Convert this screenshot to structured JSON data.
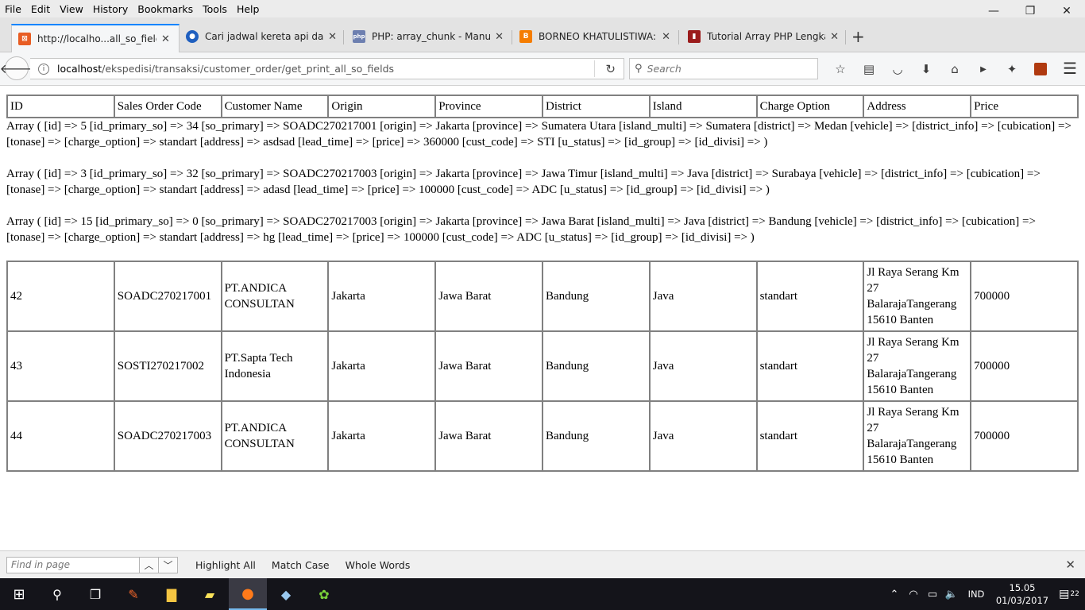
{
  "menubar": {
    "items": [
      "File",
      "Edit",
      "View",
      "History",
      "Bookmarks",
      "Tools",
      "Help"
    ]
  },
  "window_controls": {
    "minimize": "—",
    "restore": "❐",
    "close": "✕"
  },
  "tabs": [
    {
      "title": "http://localho...all_so_fields",
      "icon": "xampp-icon",
      "icon_color": "#e85d24",
      "active": true
    },
    {
      "title": "Cari jadwal kereta api dari ...",
      "icon": "train-site-icon",
      "icon_color": "#1f5fbf",
      "active": false
    },
    {
      "title": "PHP: array_chunk - Manual",
      "icon": "php-icon",
      "icon_color": "#6d7fb0",
      "active": false
    },
    {
      "title": "BORNEO KHATULISTIWA: ...",
      "icon": "blogger-icon",
      "icon_color": "#f57d00",
      "active": false
    },
    {
      "title": "Tutorial Array PHP Lengka...",
      "icon": "site-icon",
      "icon_color": "#9b1c1c",
      "active": false
    }
  ],
  "new_tab": "+",
  "nav": {
    "url_host": "localhost",
    "url_path": "/ekspedisi/transaksi/customer_order/get_print_all_so_fields",
    "search_placeholder": "Search"
  },
  "table_headers": [
    "ID",
    "Sales Order Code",
    "Customer Name",
    "Origin",
    "Province",
    "District",
    "Island",
    "Charge Option",
    "Address",
    "Price"
  ],
  "array_dump": [
    "Array ( [id] => 5 [id_primary_so] => 34 [so_primary] => SOADC270217001 [origin] => Jakarta [province] => Sumatera Utara [island_multi] => Sumatera [district] => Medan [vehicle] => [district_info] => [cubication] => [tonase] => [charge_option] => standart [address] => asdsad [lead_time] => [price] => 360000 [cust_code] => STI [u_status] => [id_group] => [id_divisi] => )",
    "Array ( [id] => 3 [id_primary_so] => 32 [so_primary] => SOADC270217003 [origin] => Jakarta [province] => Jawa Timur [island_multi] => Java [district] => Surabaya [vehicle] => [district_info] => [cubication] => [tonase] => [charge_option] => standart [address] => adasd [lead_time] => [price] => 100000 [cust_code] => ADC [u_status] => [id_group] => [id_divisi] => )",
    "Array ( [id] => 15 [id_primary_so] => 0 [so_primary] => SOADC270217003 [origin] => Jakarta [province] => Jawa Barat [island_multi] => Java [district] => Bandung [vehicle] => [district_info] => [cubication] => [tonase] => [charge_option] => standart [address] => hg [lead_time] => [price] => 100000 [cust_code] => ADC [u_status] => [id_group] => [id_divisi] => )"
  ],
  "rows": [
    [
      "42",
      "SOADC270217001",
      "PT.ANDICA CONSULTAN",
      "Jakarta",
      "Jawa Barat",
      "Bandung",
      "Java",
      "standart",
      "Jl Raya Serang Km 27 BalarajaTangerang 15610 Banten",
      "700000"
    ],
    [
      "43",
      "SOSTI270217002",
      "PT.Sapta Tech Indonesia",
      "Jakarta",
      "Jawa Barat",
      "Bandung",
      "Java",
      "standart",
      "Jl Raya Serang Km 27 BalarajaTangerang 15610 Banten",
      "700000"
    ],
    [
      "44",
      "SOADC270217003",
      "PT.ANDICA CONSULTAN",
      "Jakarta",
      "Jawa Barat",
      "Bandung",
      "Java",
      "standart",
      "Jl Raya Serang Km 27 BalarajaTangerang 15610 Banten",
      "700000"
    ]
  ],
  "findbar": {
    "placeholder": "Find in page",
    "highlight_all": "Highlight All",
    "match_case": "Match Case",
    "whole_words": "Whole Words"
  },
  "taskbar": {
    "lang": "IND",
    "time": "15.05",
    "date": "01/03/2017",
    "notifications": "22"
  }
}
